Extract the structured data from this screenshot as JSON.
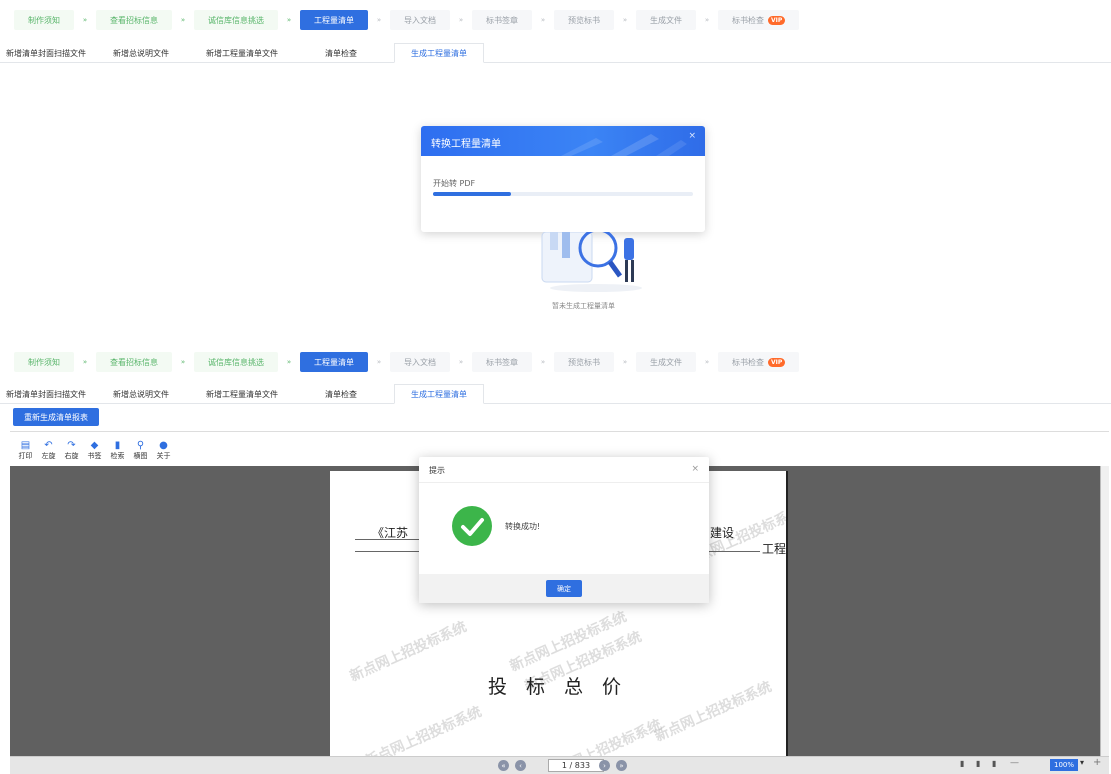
{
  "steps": [
    {
      "label": "制作须知",
      "state": "done"
    },
    {
      "label": "查看招标信息",
      "state": "done"
    },
    {
      "label": "诚信库信息挑选",
      "state": "done"
    },
    {
      "label": "工程量清单",
      "state": "active"
    },
    {
      "label": "导入文档",
      "state": "todo"
    },
    {
      "label": "标书签章",
      "state": "todo"
    },
    {
      "label": "预览标书",
      "state": "todo"
    },
    {
      "label": "生成文件",
      "state": "todo"
    },
    {
      "label": "标书检查",
      "state": "todo"
    }
  ],
  "vip_badge": "VIP",
  "tabs": [
    "新增清单封面扫描文件",
    "新增总说明文件",
    "新增工程量清单文件",
    "清单检查",
    "生成工程量清单"
  ],
  "convert_dialog": {
    "title": "转换工程量清单",
    "message": "开始转 PDF",
    "progress": 0.3,
    "close": "×"
  },
  "empty_state": {
    "text": "暂未生成工程量清单"
  },
  "regen_button": "重新生成清单报表",
  "toolbar": [
    {
      "icon": "print-icon",
      "glyph": "▤",
      "label": "打印"
    },
    {
      "icon": "rotate-left-icon",
      "glyph": "↶",
      "label": "左旋"
    },
    {
      "icon": "rotate-right-icon",
      "glyph": "↷",
      "label": "右旋"
    },
    {
      "icon": "bookmark-icon",
      "glyph": "◆",
      "label": "书签"
    },
    {
      "icon": "search-icon",
      "glyph": "▮",
      "label": "检索"
    },
    {
      "icon": "zoom-icon",
      "glyph": "⚲",
      "label": "横图"
    },
    {
      "icon": "info-icon",
      "glyph": "●",
      "label": "关于"
    }
  ],
  "document": {
    "line1_left": "《江苏",
    "line1_right": "建设",
    "line1_end": "工程",
    "heading": "投　标　总　价",
    "watermark": "新点网上招投标系统"
  },
  "pager": {
    "page": "1 / 833",
    "zoom": "100%"
  },
  "success_dialog": {
    "title": "提示",
    "message": "转换成功!",
    "ok": "确定",
    "close": "×"
  },
  "colors": {
    "primary": "#2f6fe0",
    "success": "#3cb54a",
    "done_step": "#58b56a"
  }
}
